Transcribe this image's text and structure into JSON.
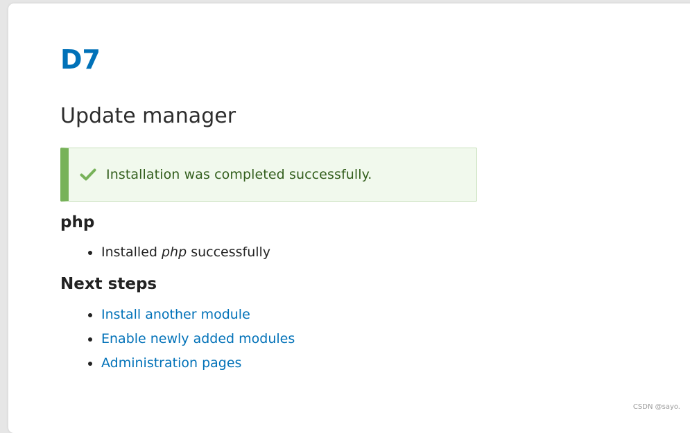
{
  "site": {
    "name": "D7"
  },
  "page": {
    "title": "Update manager"
  },
  "status": {
    "icon": "check-icon",
    "message": "Installation was completed successfully.",
    "accent_color": "#77b259",
    "background_color": "#f1f9ed"
  },
  "php_section": {
    "heading": "php",
    "items": [
      {
        "prefix": "Installed ",
        "module": "php",
        "suffix": " successfully"
      }
    ]
  },
  "next_steps": {
    "heading": "Next steps",
    "links": [
      {
        "label": "Install another module"
      },
      {
        "label": "Enable newly added modules"
      },
      {
        "label": "Administration pages"
      }
    ]
  },
  "watermark": "CSDN @sayo.",
  "colors": {
    "link": "#0071b8",
    "text": "#222222"
  }
}
